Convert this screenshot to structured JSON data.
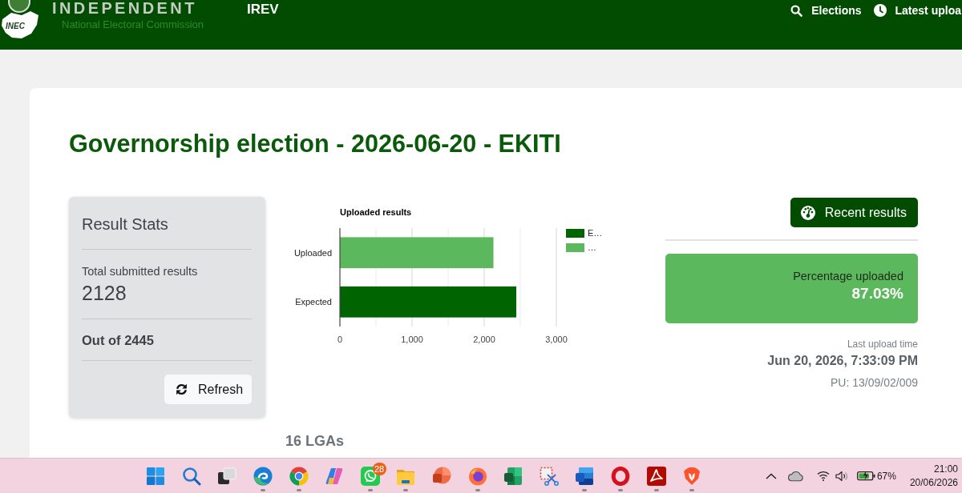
{
  "header": {
    "logo_text": "INEC",
    "brand": "INDEPENDENT",
    "subtitle": "National Electoral Commission",
    "app_name": "IREV",
    "nav": [
      {
        "kind": "search",
        "label": "Elections"
      },
      {
        "kind": "clock",
        "label": "Latest uploa"
      }
    ]
  },
  "page": {
    "title": "Governorship election - 2026-06-20 - EKITI"
  },
  "result_stats": {
    "title": "Result Stats",
    "total_label": "Total submitted results",
    "total_value": "2128",
    "out_of": "Out of 2445",
    "refresh_button": "Refresh"
  },
  "chart": {
    "chart_data": {
      "type": "bar",
      "orientation": "horizontal",
      "stacked": true,
      "title": "Uploaded results",
      "categories": [
        "Uploaded",
        "Expected"
      ],
      "series": [
        {
          "name": "E…",
          "color": "#006400",
          "values": [
            null,
            2445
          ]
        },
        {
          "name": "…",
          "color": "#5cb85c",
          "values": [
            2128,
            null
          ]
        }
      ],
      "xlim": [
        0,
        3000
      ],
      "xticks": [
        0,
        {
          "value": 1000,
          "label": "1,000"
        },
        {
          "value": 2000,
          "label": "2,000"
        },
        {
          "value": 3000,
          "label": "3,000"
        }
      ],
      "legend": "right"
    }
  },
  "summary": {
    "recent_button": "Recent results",
    "percentage_label": "Percentage uploaded",
    "percentage_value": "87.03%",
    "last_upload_label": "Last upload time",
    "last_upload_time": "Jun 20, 2026, 7:33:09 PM",
    "pu": "PU: 13/09/02/009"
  },
  "lgas_heading": "16 LGAs",
  "taskbar": {
    "apps": [
      {
        "kind": "start",
        "running": false
      },
      {
        "kind": "search",
        "running": false
      },
      {
        "kind": "taskview",
        "running": false
      },
      {
        "kind": "edge",
        "running": true
      },
      {
        "kind": "chrome",
        "running": true
      },
      {
        "kind": "copilot",
        "running": false
      },
      {
        "kind": "whatsapp",
        "running": true,
        "badge": "28"
      },
      {
        "kind": "files",
        "running": true
      },
      {
        "kind": "powerpoint",
        "running": false
      },
      {
        "kind": "firefox",
        "running": true
      },
      {
        "kind": "excel",
        "running": false
      },
      {
        "kind": "snipping",
        "running": false
      },
      {
        "kind": "word",
        "running": true
      },
      {
        "kind": "opera",
        "running": true
      },
      {
        "kind": "acrobat",
        "running": true
      },
      {
        "kind": "brave",
        "running": true
      }
    ],
    "tray": {
      "battery_percent": "67%",
      "time": "21:00",
      "date": "20/06/2026"
    }
  }
}
